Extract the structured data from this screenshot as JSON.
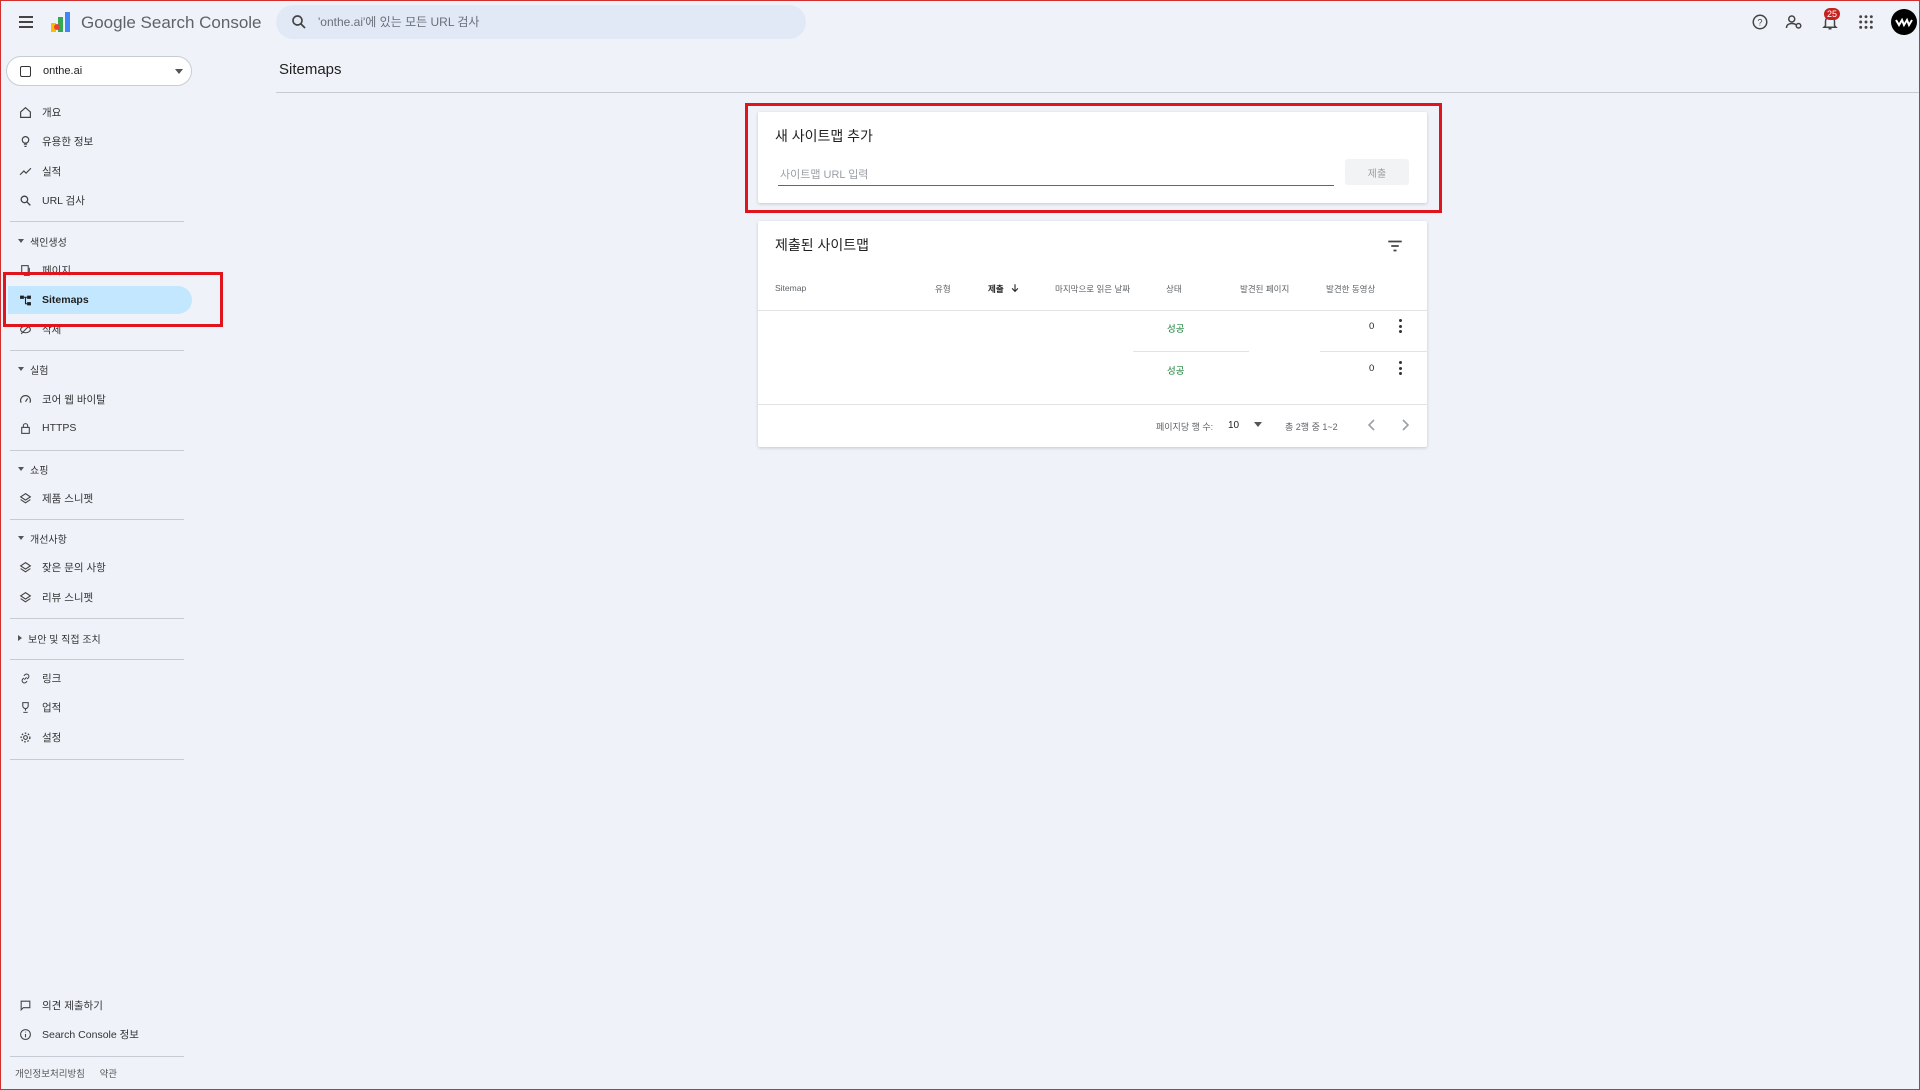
{
  "app": {
    "brand": "Google Search Console",
    "search_placeholder": "'onthe.ai'에 있는 모든 URL 검사",
    "notification_count": "25"
  },
  "sidebar": {
    "property": "onthe.ai",
    "top_items": [
      {
        "label": "개요",
        "icon": "home-icon"
      },
      {
        "label": "유용한 정보",
        "icon": "lightbulb-icon"
      },
      {
        "label": "실적",
        "icon": "trending-up-icon"
      },
      {
        "label": "URL 검사",
        "icon": "search-icon"
      }
    ],
    "sections": [
      {
        "label": "색인생성",
        "items": [
          "페이지",
          "Sitemaps",
          "삭제"
        ]
      },
      {
        "label": "실험",
        "items": [
          "코어 웹 바이탈",
          "HTTPS"
        ]
      },
      {
        "label": "쇼핑",
        "items": [
          "제품 스니펫"
        ]
      },
      {
        "label": "개선사항",
        "items": [
          "잦은 문의 사항",
          "리뷰 스니펫"
        ]
      },
      {
        "label": "보안 및 직접 조치",
        "items": []
      }
    ],
    "bottom_items": [
      {
        "label": "링크",
        "icon": "link-icon"
      },
      {
        "label": "업적",
        "icon": "trophy-icon"
      },
      {
        "label": "설정",
        "icon": "gear-icon"
      }
    ],
    "footer_items": [
      {
        "label": "의견 제출하기",
        "icon": "feedback-icon"
      },
      {
        "label": "Search Console 정보",
        "icon": "info-icon"
      }
    ],
    "footer_links": [
      "개인정보처리방침",
      "약관"
    ]
  },
  "main": {
    "title": "Sitemaps",
    "add_card": {
      "title": "새 사이트맵 추가",
      "input_placeholder": "사이트맵 URL 입력",
      "submit_label": "제출"
    },
    "submitted_card": {
      "title": "제출된 사이트맵",
      "columns": [
        "Sitemap",
        "유형",
        "제출",
        "마지막으로 읽은 날짜",
        "상태",
        "발견된 페이지",
        "발견한 동영상"
      ],
      "rows": [
        {
          "sitemap": "",
          "type": "",
          "submitted": "",
          "last_read": "",
          "status": "성공",
          "pages": "",
          "videos": "0"
        },
        {
          "sitemap": "",
          "type": "",
          "submitted": "",
          "last_read": "",
          "status": "성공",
          "pages": "",
          "videos": "0"
        }
      ],
      "rows_per_page_label": "페이지당 행 수:",
      "rows_per_page": "10",
      "range_label": "총 2행 중 1~2"
    }
  }
}
